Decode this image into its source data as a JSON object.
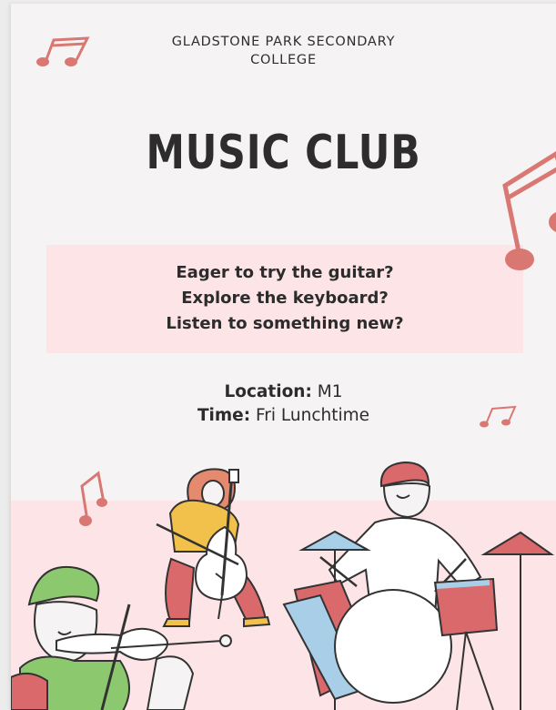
{
  "header": {
    "school_line1": "GLADSTONE PARK SECONDARY",
    "school_line2": "COLLEGE"
  },
  "title": "MUSIC CLUB",
  "questions": [
    "Eager to try the guitar?",
    "Explore the keyboard?",
    "Listen to something new?"
  ],
  "details": {
    "location_label": "Location:",
    "location_value": "M1",
    "time_label": "Time:",
    "time_value": "Fri Lunchtime"
  },
  "colors": {
    "note": "#d97873",
    "pink_band": "#fde5e7",
    "background": "#f5f3f4",
    "text": "#2d2d2d"
  },
  "icons": [
    "music-note-icon",
    "cellist-illustration",
    "drummer-illustration",
    "violinist-illustration"
  ]
}
